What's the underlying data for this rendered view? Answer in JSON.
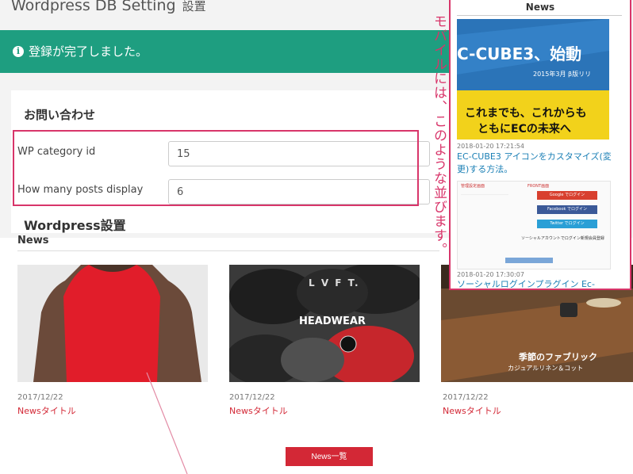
{
  "page": {
    "title": "Wordpress DB Setting",
    "title_sub": "設置"
  },
  "alert": {
    "icon": "info-icon",
    "message": "登録が完了しました。",
    "color": "#1e9e80"
  },
  "form": {
    "heading": "お問い合わせ",
    "fields": [
      {
        "label": "WP category id",
        "value": "15"
      },
      {
        "label": "How many posts display",
        "value": "6"
      }
    ]
  },
  "preview": {
    "heading": "Wordpress設置",
    "news_heading": "News",
    "items": [
      {
        "date": "2017/12/22",
        "title": "Newsタイトル"
      },
      {
        "date": "2017/12/22",
        "title": "Newsタイトル"
      },
      {
        "date": "2017/12/22",
        "title": "Newsタイトル"
      }
    ],
    "thumb2_text": "HEADWEAR",
    "thumb2_cap": "L V F T.",
    "thumb3_text": "季節のファブリック",
    "thumb3_sub": "カジュアルリネン＆コット",
    "list_button": "News一覧",
    "accent": "#d32836"
  },
  "annotation": {
    "text": "モバイルには、このような並びます。",
    "color": "#d8356a"
  },
  "mobile": {
    "heading": "News",
    "banner_line1": "C-CUBE3、始動",
    "banner_line2": "2015年3月 β版リリ",
    "banner_line3": "これまでも、これからも",
    "banner_line4": "ともにECの未来へ",
    "post1_date": "2018-01-20 17:21:54",
    "post1_title": "EC-CUBE3 アイコンをカスタマイズ(変更)する方法。",
    "post2_date": "2018-01-20 17:30:07",
    "post2_title": "ソーシャルログインプラグイン Ec-",
    "shot_head": "管理設定画面",
    "shot_front": "FRONT画面",
    "shot_btn_google": "Google でログイン",
    "shot_btn_facebook": "Facebook でログイン",
    "shot_btn_twitter": "Twitter でログイン",
    "shot_caption": "ソーシャルアカウントでログイン新規会員登録"
  }
}
